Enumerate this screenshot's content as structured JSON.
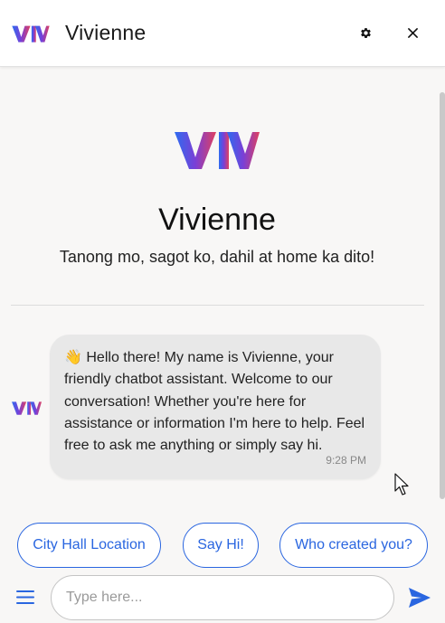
{
  "header": {
    "title": "Vivienne",
    "logo_text": "VIV",
    "settings_icon": "gear-icon",
    "close_icon": "close-icon"
  },
  "hero": {
    "name": "Vivienne",
    "tagline": "Tanong mo, sagot ko, dahil at home ka dito!"
  },
  "messages": [
    {
      "sender": "bot",
      "emoji": "👋",
      "text": "Hello there! My name is Vivienne, your friendly chatbot assistant. Welcome to our conversation! Whether you're here for assistance or information I'm here to help. Feel free to ask me anything or simply say hi.",
      "time": "9:28 PM"
    }
  ],
  "quick_replies": [
    "City Hall Location",
    "Say Hi!",
    "Who created you?"
  ],
  "composer": {
    "placeholder": "Type here...",
    "value": "",
    "menu_icon": "hamburger-menu-icon",
    "send_icon": "send-icon"
  },
  "colors": {
    "accent": "#2a66e0",
    "logo_gradient": [
      "#2d6cf0",
      "#7a3fd6",
      "#e0405e"
    ],
    "background": "#f8f7f6",
    "bubble": "#e8e8e8"
  }
}
